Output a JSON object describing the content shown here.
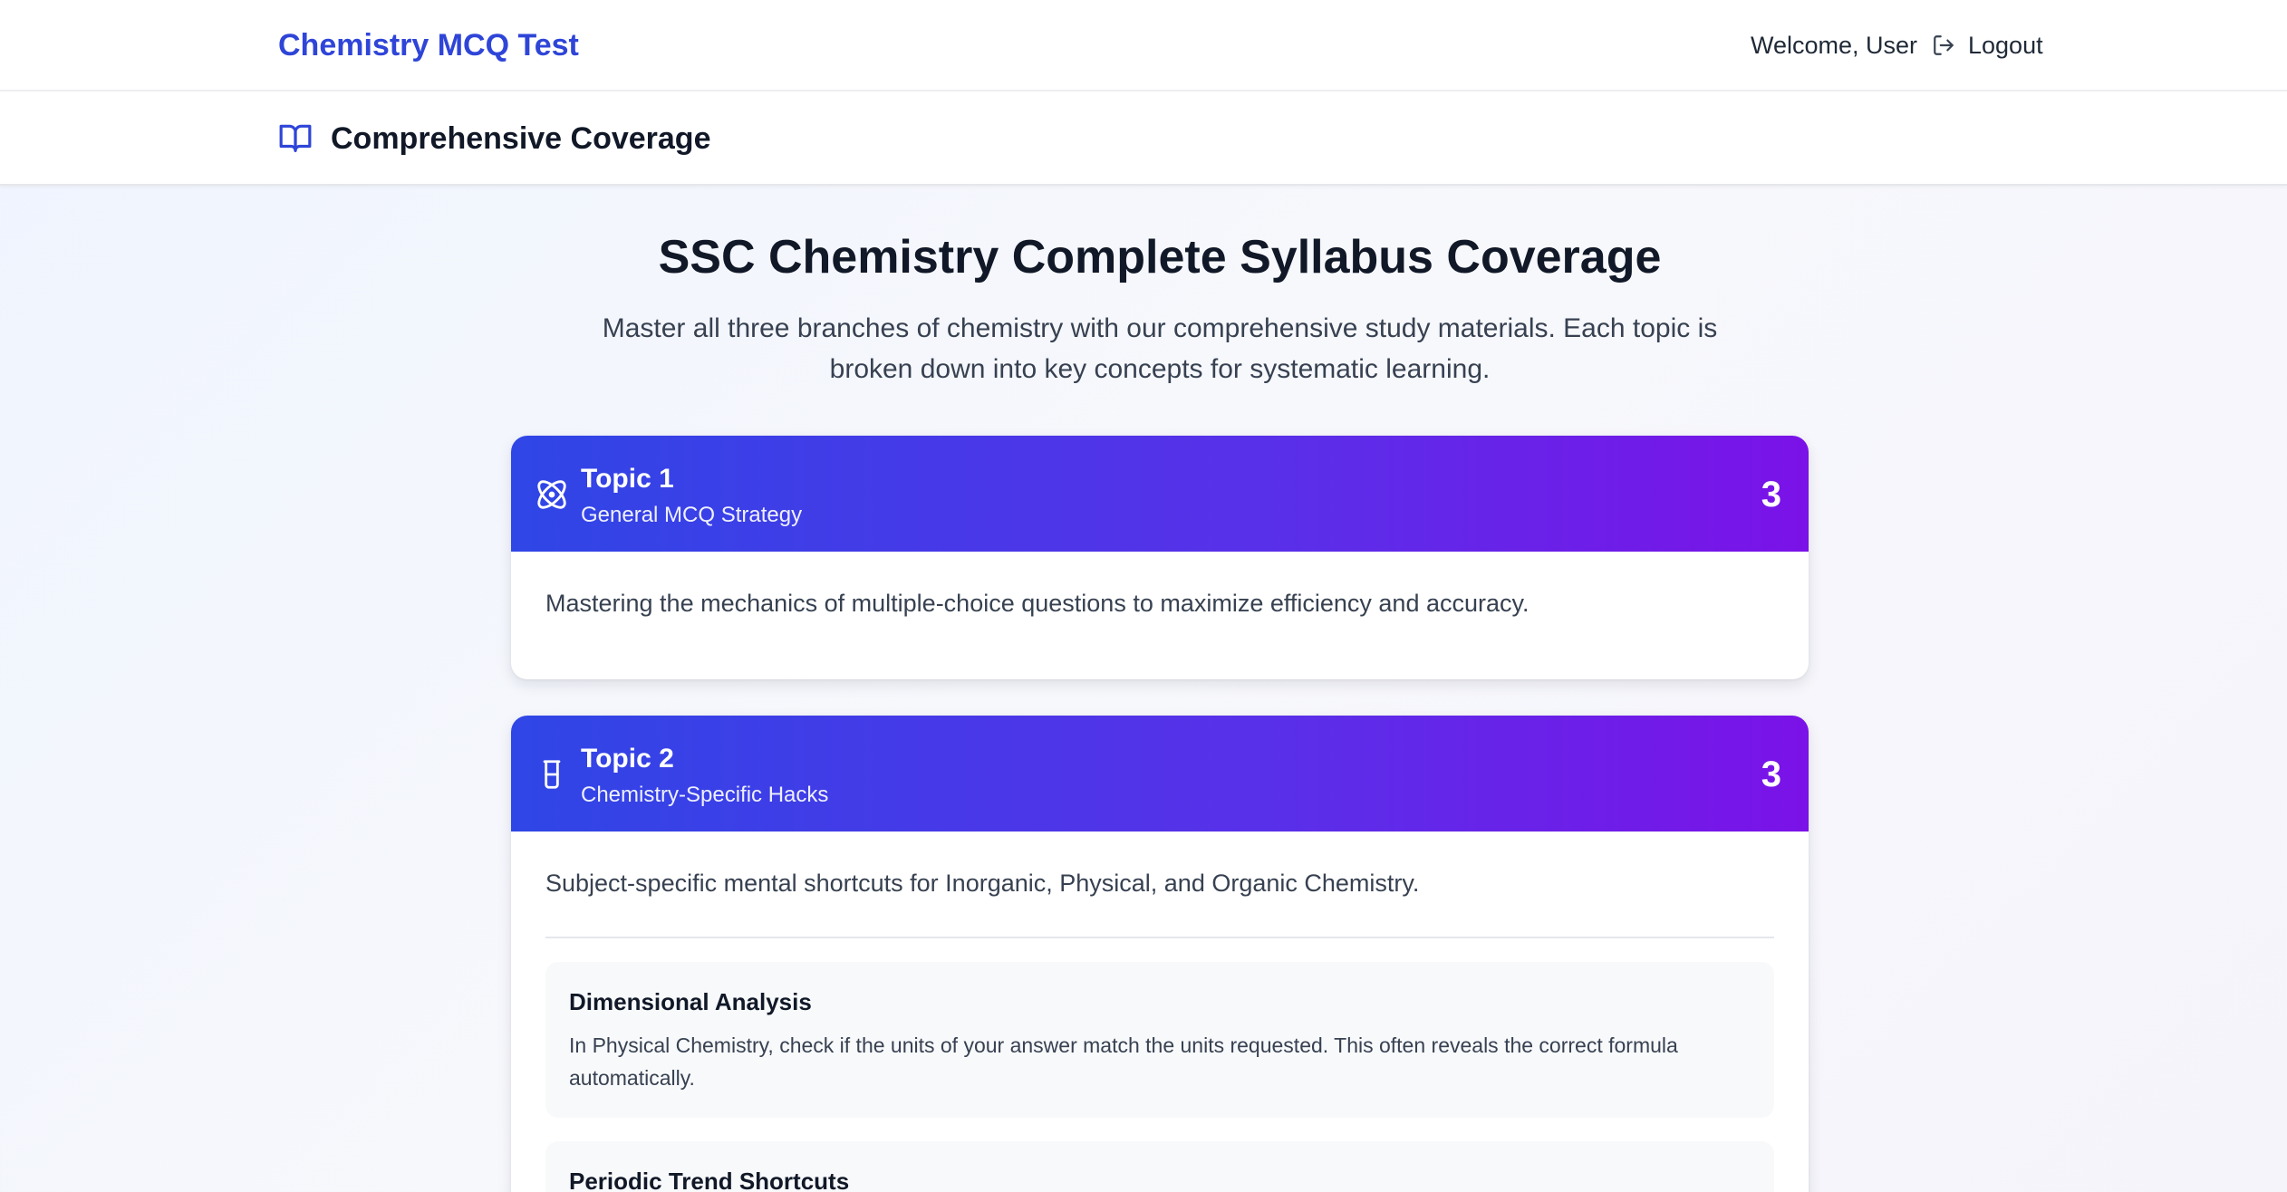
{
  "navbar": {
    "brand": "Chemistry MCQ Test",
    "welcome": "Welcome, User",
    "logout_label": "Logout"
  },
  "subheader": {
    "title": "Comprehensive Coverage"
  },
  "hero": {
    "title": "SSC Chemistry Complete Syllabus Coverage",
    "description": "Master all three branches of chemistry with our comprehensive study materials. Each topic is broken down into key concepts for systematic learning."
  },
  "topics": [
    {
      "topic": "Topic 1",
      "subtitle": "General MCQ Strategy",
      "count": "3",
      "icon": "atom-icon",
      "description": "Mastering the mechanics of multiple-choice questions to maximize efficiency and accuracy."
    },
    {
      "topic": "Topic 2",
      "subtitle": "Chemistry-Specific Hacks",
      "count": "3",
      "icon": "beaker-icon",
      "description": "Subject-specific mental shortcuts for Inorganic, Physical, and Organic Chemistry.",
      "concepts": [
        {
          "title": "Dimensional Analysis",
          "text": "In Physical Chemistry, check if the units of your answer match the units requested. This often reveals the correct formula automatically."
        },
        {
          "title": "Periodic Trend Shortcuts",
          "text": ""
        }
      ]
    }
  ],
  "colors": {
    "brand": "#2f45d8",
    "header_gradient_start": "#2f46e6",
    "header_gradient_end": "#7b12e8"
  }
}
